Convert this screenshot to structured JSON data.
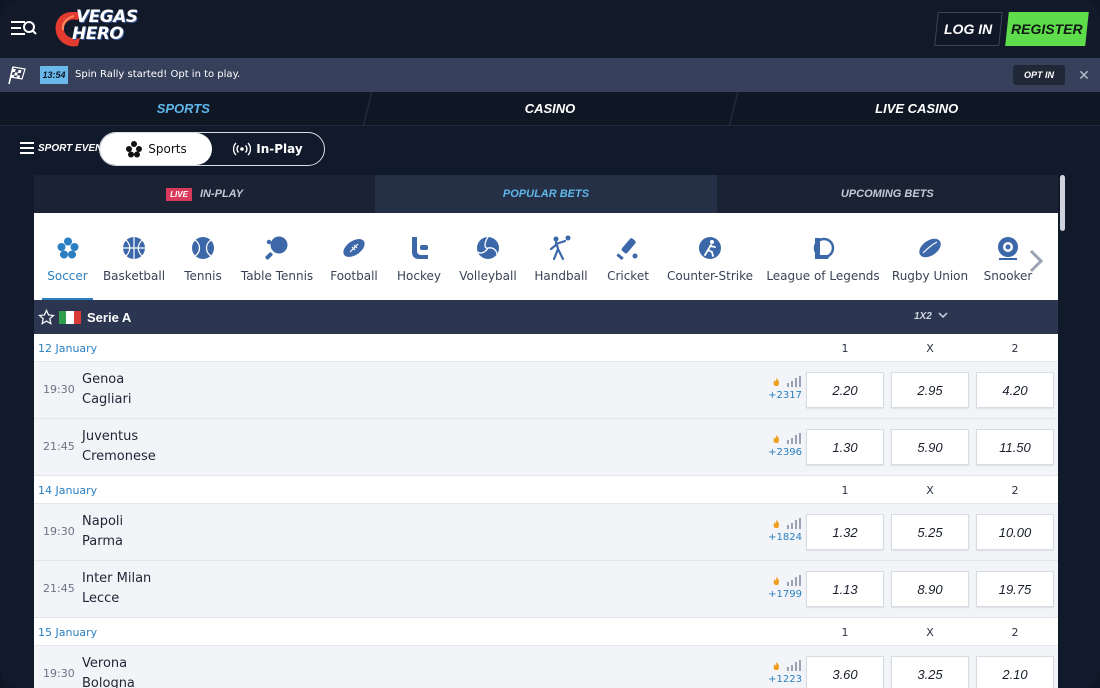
{
  "header": {
    "brand_line1": "VEGAS",
    "brand_line2": "HERO",
    "login_label": "LOG IN",
    "register_label": "REGISTER"
  },
  "promo": {
    "timer": "13:54",
    "text": "Spin Rally started! Opt in to play.",
    "opt_in_label": "OPT IN",
    "close_glyph": "✕"
  },
  "main_tabs": [
    {
      "label": "SPORTS",
      "active": true
    },
    {
      "label": "CASINO",
      "active": false
    },
    {
      "label": "LIVE CASINO",
      "active": false
    }
  ],
  "sport_events": {
    "label": "SPORT EVENTS",
    "toggle": [
      {
        "label": "Sports",
        "icon": "soccer-ball-icon",
        "active": true
      },
      {
        "label": "In-Play",
        "icon": "broadcast-icon",
        "active": false
      }
    ]
  },
  "bet_tabs": [
    {
      "label": "IN-PLAY",
      "badge": "LIVE",
      "active": false
    },
    {
      "label": "POPULAR BETS",
      "active": true
    },
    {
      "label": "UPCOMING BETS",
      "active": false
    }
  ],
  "sports": [
    {
      "label": "Soccer",
      "icon": "soccer-icon",
      "active": true
    },
    {
      "label": "Basketball",
      "icon": "basketball-icon"
    },
    {
      "label": "Tennis",
      "icon": "tennis-icon"
    },
    {
      "label": "Table Tennis",
      "icon": "table-tennis-icon"
    },
    {
      "label": "Football",
      "icon": "football-icon"
    },
    {
      "label": "Hockey",
      "icon": "hockey-icon"
    },
    {
      "label": "Volleyball",
      "icon": "volleyball-icon"
    },
    {
      "label": "Handball",
      "icon": "handball-icon"
    },
    {
      "label": "Cricket",
      "icon": "cricket-icon"
    },
    {
      "label": "Counter-Strike",
      "icon": "counter-strike-icon"
    },
    {
      "label": "League of Legends",
      "icon": "league-of-legends-icon"
    },
    {
      "label": "Rugby Union",
      "icon": "rugby-icon"
    },
    {
      "label": "Snooker",
      "icon": "snooker-icon"
    }
  ],
  "league": {
    "name": "Serie A",
    "market": "1X2",
    "flag_colors": [
      "#2f9e4a",
      "#ffffff",
      "#d93a3a"
    ]
  },
  "odds_headers": [
    "1",
    "X",
    "2"
  ],
  "days": [
    {
      "date": "12 January",
      "matches": [
        {
          "time": "19:30",
          "home": "Genoa",
          "away": "Cagliari",
          "more": "+2317",
          "odds": [
            "2.20",
            "2.95",
            "4.20"
          ]
        },
        {
          "time": "21:45",
          "home": "Juventus",
          "away": "Cremonese",
          "more": "+2396",
          "odds": [
            "1.30",
            "5.90",
            "11.50"
          ]
        }
      ]
    },
    {
      "date": "14 January",
      "matches": [
        {
          "time": "19:30",
          "home": "Napoli",
          "away": "Parma",
          "more": "+1824",
          "odds": [
            "1.32",
            "5.25",
            "10.00"
          ]
        },
        {
          "time": "21:45",
          "home": "Inter Milan",
          "away": "Lecce",
          "more": "+1799",
          "odds": [
            "1.13",
            "8.90",
            "19.75"
          ]
        }
      ]
    },
    {
      "date": "15 January",
      "matches": [
        {
          "time": "19:30",
          "home": "Verona",
          "away": "Bologna",
          "more": "+1223",
          "odds": [
            "3.60",
            "3.25",
            "2.10"
          ]
        }
      ]
    }
  ],
  "colors": {
    "accent_blue": "#5fb7ec",
    "register_green": "#5fdc4c",
    "live_red": "#d93a5c",
    "stat_orange": "#f0a020"
  }
}
